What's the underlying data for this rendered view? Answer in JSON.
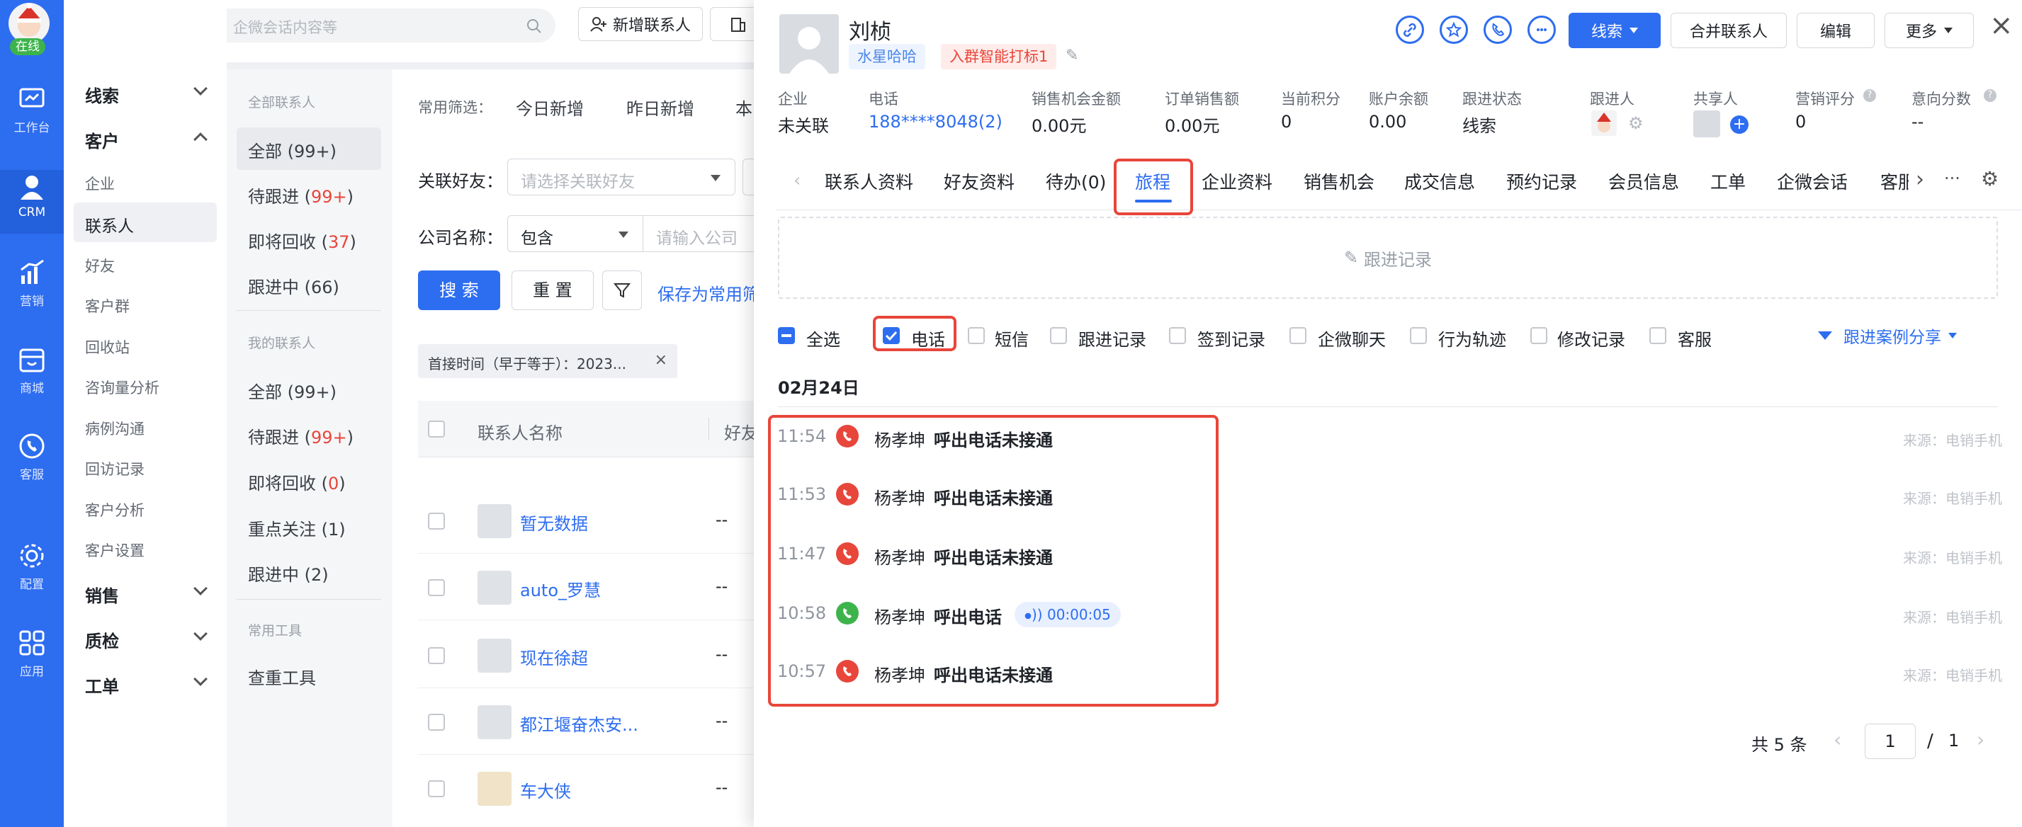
{
  "left_nav": {
    "status": "在线",
    "items": [
      {
        "icon": "workbench-icon",
        "label": "工作台"
      },
      {
        "icon": "crm-person-icon",
        "label": "CRM"
      },
      {
        "icon": "marketing-chart-icon",
        "label": "营销"
      },
      {
        "icon": "mall-icon",
        "label": "商城"
      },
      {
        "icon": "service-phone-icon",
        "label": "客服"
      },
      {
        "icon": "config-gear-icon",
        "label": "配置"
      },
      {
        "icon": "apps-grid-icon",
        "label": "应用"
      }
    ]
  },
  "topbar": {
    "search_placeholder": "搜索联系人、企业、企微会话内容等",
    "add_contact": "新增联系人"
  },
  "sidebar": {
    "groups": {
      "leads": "线索",
      "customers": "客户",
      "sales": "销售",
      "qc": "质检",
      "ticket": "工单"
    },
    "customer_items": [
      "企业",
      "联系人",
      "好友",
      "客户群",
      "回收站",
      "咨询量分析",
      "病例沟通",
      "回访记录",
      "客户分析",
      "客户设置"
    ]
  },
  "filter_panel": {
    "all_header": "全部联系人",
    "all": "全部 (99+)",
    "pending_pre": "待跟进 (",
    "pending_num": "99+",
    "pending_post": ")",
    "recycle_pre": "即将回收 (",
    "recycle_num": "37",
    "recycle_post": ")",
    "following": "跟进中 (66)",
    "my_header": "我的联系人",
    "my_all": "全部 (99+)",
    "my_pending_pre": "待跟进 (",
    "my_pending_num": "99+",
    "my_pending_post": ")",
    "my_recycle_pre": "即将回收 (",
    "my_recycle_num": "0",
    "my_recycle_post": ")",
    "my_focus": "重点关注 (1)",
    "my_following": "跟进中 (2)",
    "tools_header": "常用工具",
    "dedupe_tool": "查重工具"
  },
  "main_list": {
    "common_filter_label": "常用筛选：",
    "today_new": "今日新增",
    "yesterday_new": "昨日新增",
    "this_partial": "本",
    "friend_label": "关联好友：",
    "friend_placeholder": "请选择关联好友",
    "company_label": "公司名称：",
    "company_op": "包含",
    "company_placeholder": "请输入公司",
    "search_btn": "搜 索",
    "reset_btn": "重 置",
    "save_filter": "保存为常用筛",
    "filter_tag": "首接时间（早于等于）：2023...",
    "col_name": "联系人名称",
    "col_remark": "好友备注",
    "rows": [
      {
        "name": "暂无数据",
        "remark": "--"
      },
      {
        "name": "auto_罗慧",
        "remark": "--"
      },
      {
        "name": "现在徐超",
        "remark": "--"
      },
      {
        "name": "都江堰奋杰安...",
        "remark": "--"
      },
      {
        "name": "车大侠",
        "remark": "--"
      }
    ]
  },
  "detail": {
    "name": "刘桢",
    "tag_blue": "水星哈哈",
    "tag_red": "入群智能打标1",
    "stage_btn": "线索",
    "merge_btn": "合并联系人",
    "edit_btn": "编辑",
    "more_btn": "更多",
    "fields": [
      {
        "label": "企业",
        "value": "未关联"
      },
      {
        "label": "电话",
        "value": "188****8048(2)"
      },
      {
        "label": "销售机会金额",
        "value": "0.00元"
      },
      {
        "label": "订单销售额",
        "value": "0.00元"
      },
      {
        "label": "当前积分",
        "value": "0"
      },
      {
        "label": "账户余额",
        "value": "0.00"
      },
      {
        "label": "跟进状态",
        "value": "线索"
      },
      {
        "label": "跟进人",
        "value": ""
      },
      {
        "label": "共享人",
        "value": ""
      },
      {
        "label": "营销评分",
        "value": "0"
      },
      {
        "label": "意向分数",
        "value": "--"
      }
    ],
    "tabs": [
      "联系人资料",
      "好友资料",
      "待办(0)",
      "旅程",
      "企业资料",
      "销售机会",
      "成交信息",
      "预约记录",
      "会员信息",
      "工单",
      "企微会话",
      "客服"
    ],
    "active_tab": "旅程",
    "follow_record": "跟进记录",
    "filters": {
      "all": "全选",
      "phone": "电话",
      "sms": "短信",
      "follow": "跟进记录",
      "checkin": "签到记录",
      "wecom": "企微聊天",
      "behavior": "行为轨迹",
      "modify": "修改记录",
      "service": "客服"
    },
    "share": "跟进案例分享",
    "date": "02月24日",
    "records": [
      {
        "time": "11:54",
        "agent": "杨孝坤",
        "action": "呼出电话未接通",
        "src": "来源：电销手机",
        "ok": false,
        "duration": ""
      },
      {
        "time": "11:53",
        "agent": "杨孝坤",
        "action": "呼出电话未接通",
        "src": "来源：电销手机",
        "ok": false,
        "duration": ""
      },
      {
        "time": "11:47",
        "agent": "杨孝坤",
        "action": "呼出电话未接通",
        "src": "来源：电销手机",
        "ok": false,
        "duration": ""
      },
      {
        "time": "10:58",
        "agent": "杨孝坤",
        "action": "呼出电话",
        "src": "来源：电销手机",
        "ok": true,
        "duration": "00:00:05"
      },
      {
        "time": "10:57",
        "agent": "杨孝坤",
        "action": "呼出电话未接通",
        "src": "来源：电销手机",
        "ok": false,
        "duration": ""
      }
    ],
    "pager": {
      "total": "共 5 条",
      "page": "1",
      "sep": "/",
      "pages": "1"
    }
  },
  "colors": {
    "primary": "#2d6df0",
    "danger": "#e8463a",
    "success": "#3cb44b"
  }
}
